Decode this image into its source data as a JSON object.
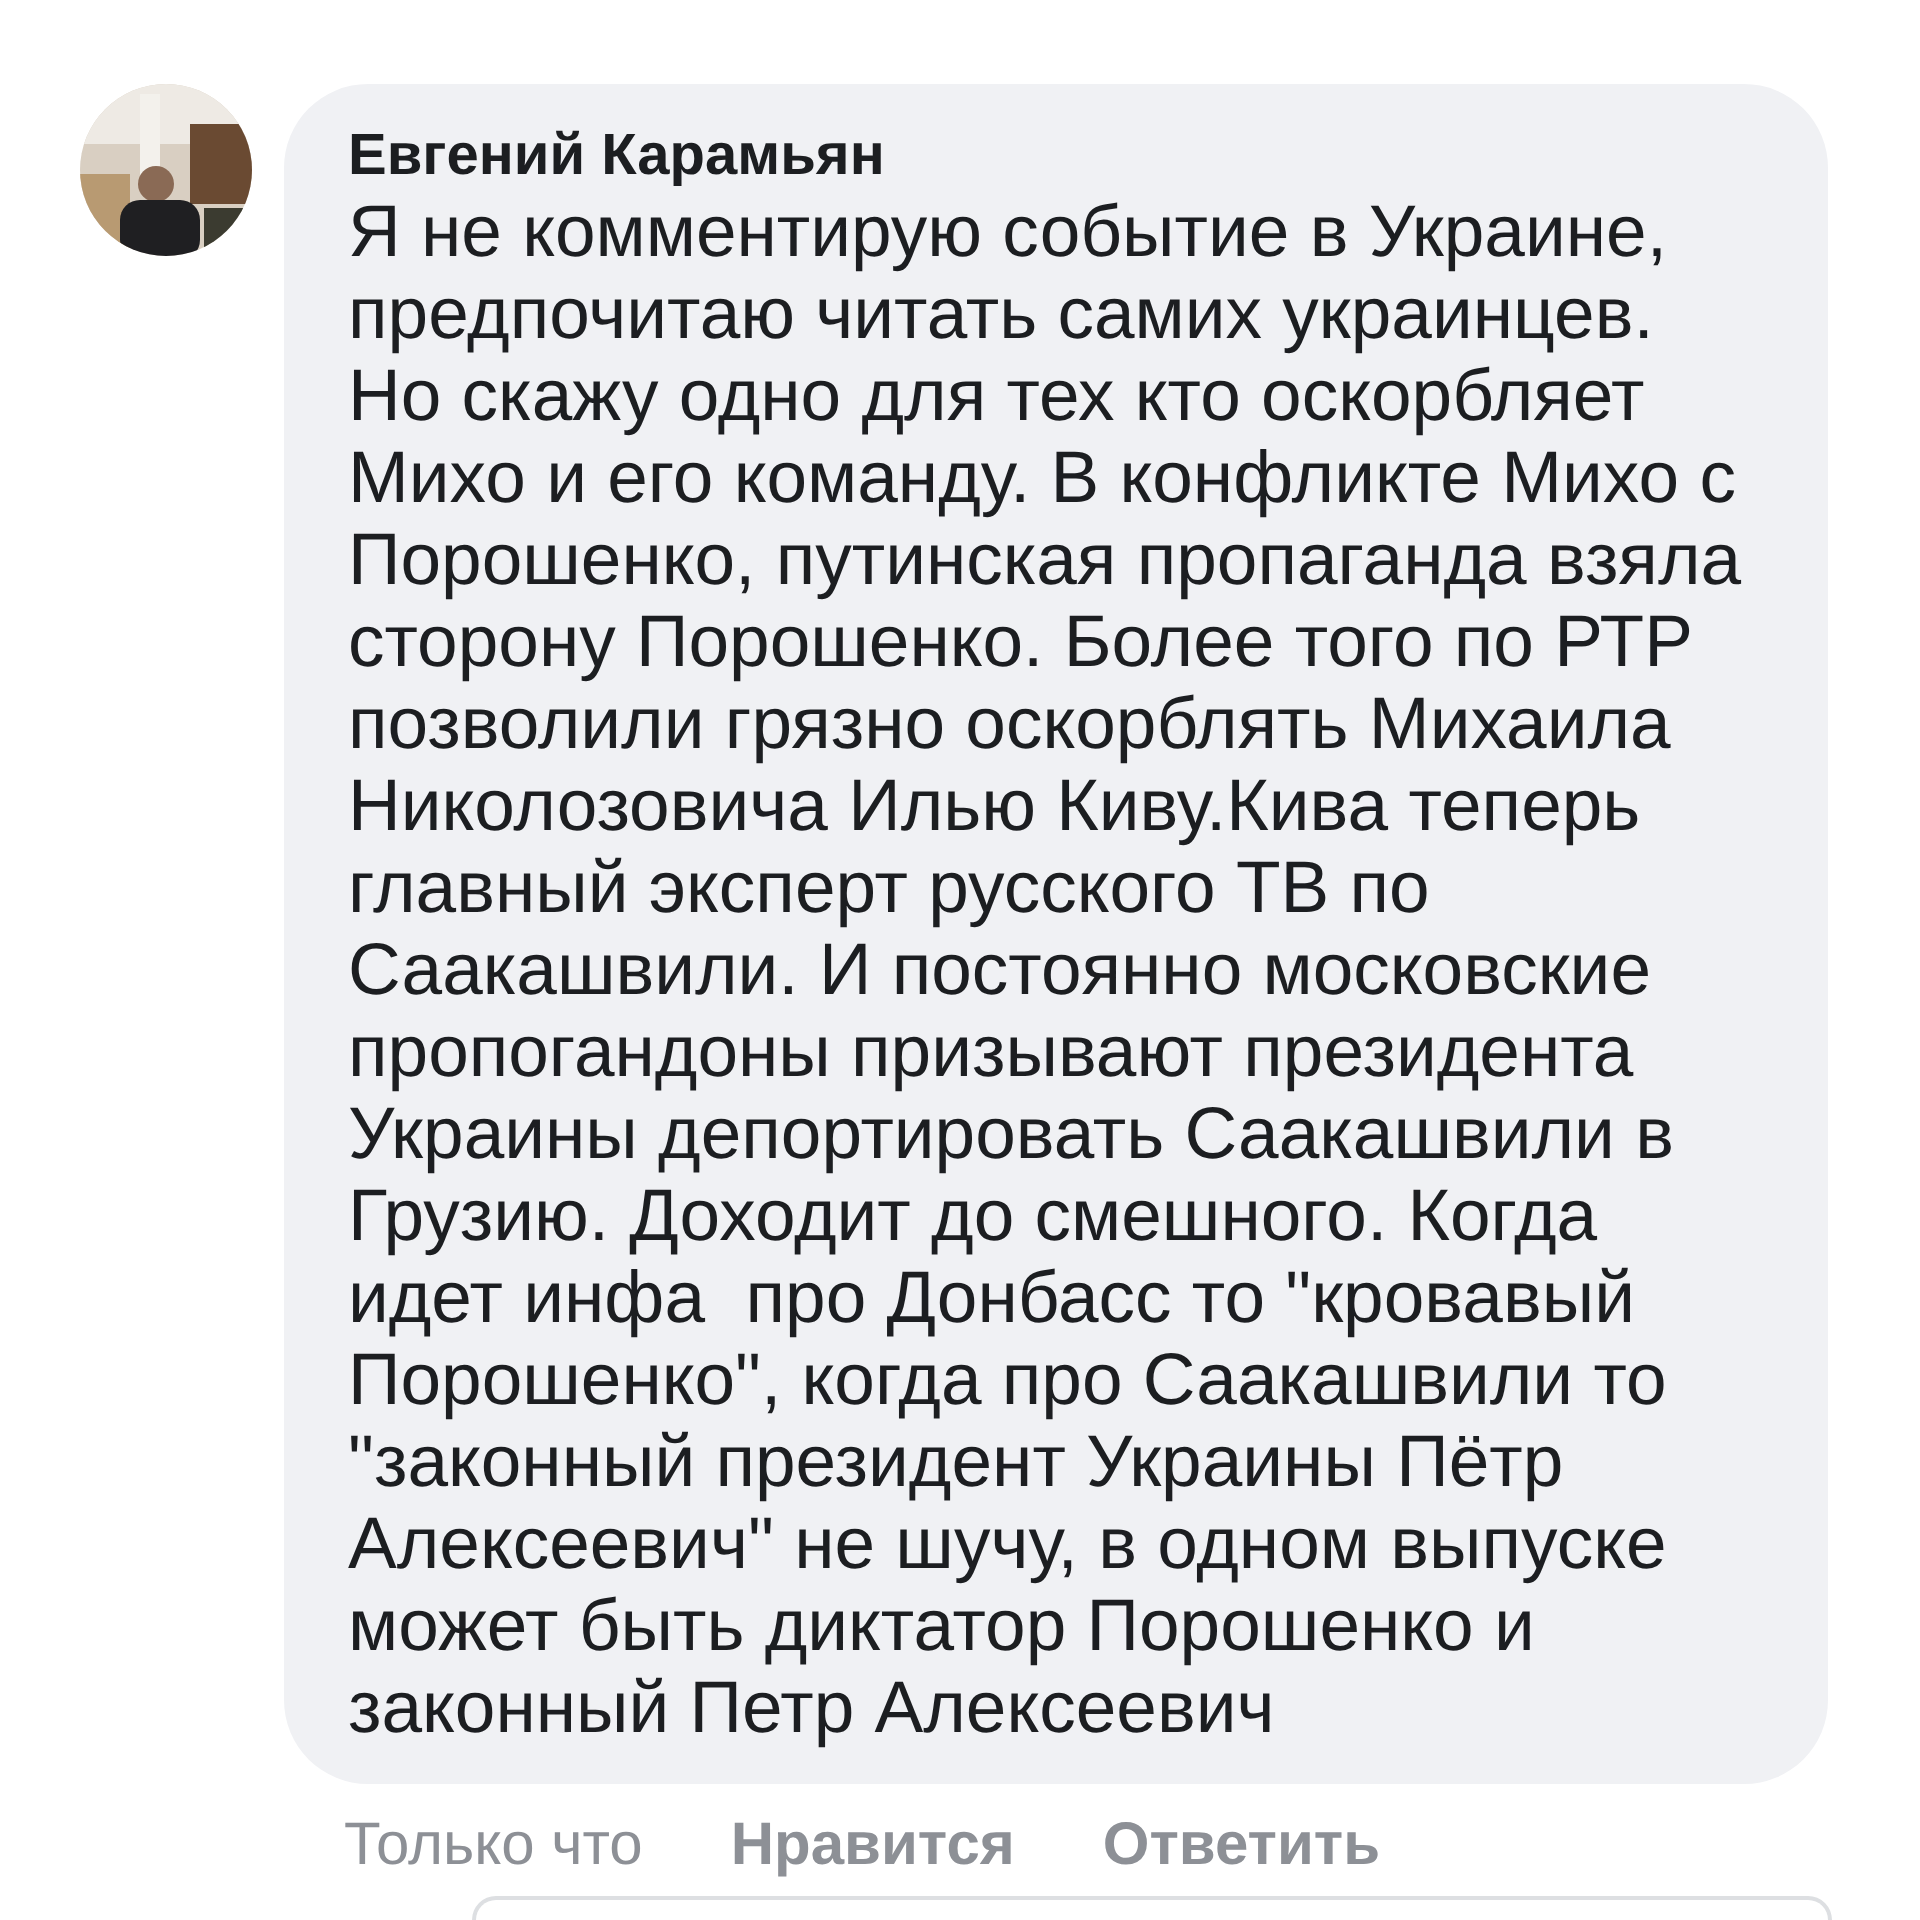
{
  "comment": {
    "author": "Евгений Карамьян",
    "lines": [
      "Я не комментирую событие в Украине,",
      "предпочитаю читать самих украинцев.",
      "Но скажу одно для тех кто оскорбляет",
      "Михо и его команду. В конфликте Михо с",
      "Порошенко, путинская пропаганда взяла",
      "сторону Порошенко. Более того по РТР",
      "позволили грязно оскорблять Михаила",
      "Николозовича Илью Киву.Кива теперь",
      "главный эксперт русского ТВ по",
      "Саакашвили. И постоянно московские",
      "пропогандоны призывают президента",
      "Украины депортировать Саакашвили в",
      "Грузию. Доходит до смешного. Когда",
      "идет инфа  про Донбасс то \"кровавый",
      "Порошенко\", когда про Саакашвили то",
      "\"законный президент Украины Пётр",
      "Алексеевич\" не шучу, в одном выпуске",
      "может быть диктатор Порошенко и",
      "законный Петр Алексеевич"
    ],
    "time": "Только что",
    "actions": [
      "Нравится",
      "Ответить"
    ]
  }
}
